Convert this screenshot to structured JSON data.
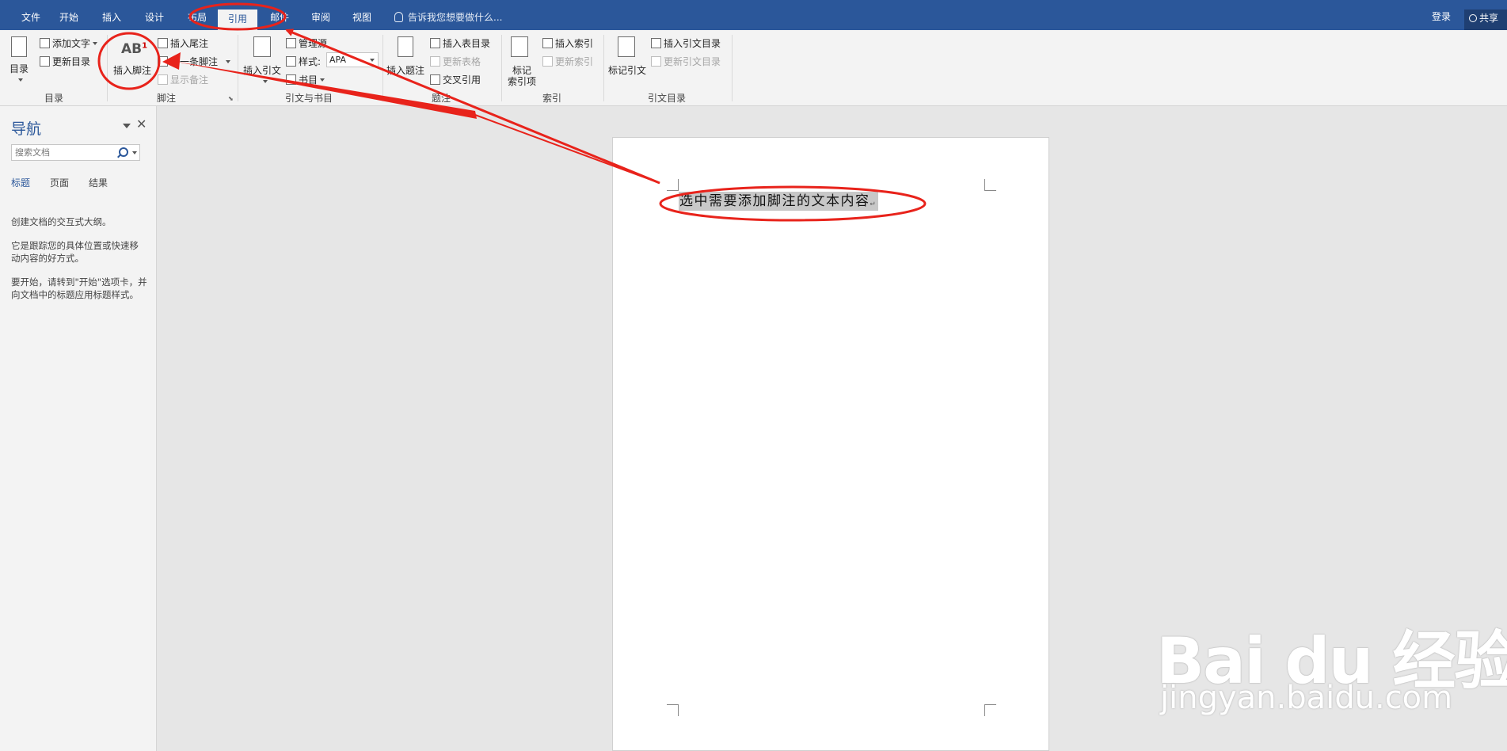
{
  "tabs": [
    {
      "label": "文件"
    },
    {
      "label": "开始"
    },
    {
      "label": "插入"
    },
    {
      "label": "设计"
    },
    {
      "label": "布局"
    },
    {
      "label": "引用"
    },
    {
      "label": "邮件"
    },
    {
      "label": "审阅"
    },
    {
      "label": "视图"
    }
  ],
  "active_tab": "引用",
  "tell_me": "告诉我您想要做什么...",
  "signin": "登录",
  "share": "共享",
  "ribbon": {
    "toc": {
      "toc_button": "目录",
      "add_text": "添加文字",
      "update_toc": "更新目录",
      "group": "目录"
    },
    "footnotes": {
      "insert_footnote_icon_text": "AB",
      "insert_footnote_sup": "1",
      "insert_footnote": "插入脚注",
      "insert_endnote": "插入尾注",
      "next_footnote": "下一条脚注",
      "show_notes": "显示备注",
      "group": "脚注"
    },
    "citations": {
      "insert_citation": "插入引文",
      "manage_sources": "管理源",
      "style_label": "样式:",
      "style_value": "APA",
      "bibliography": "书目",
      "group": "引文与书目"
    },
    "captions": {
      "insert_caption": "插入题注",
      "insert_table_of_figures": "插入表目录",
      "update_table": "更新表格",
      "cross_reference": "交叉引用",
      "group": "题注"
    },
    "index": {
      "mark_entry_1": "标记",
      "mark_entry_2": "索引项",
      "insert_index": "插入索引",
      "update_index": "更新索引",
      "group": "索引"
    },
    "toa": {
      "mark_citation": "标记引文",
      "insert_toa": "插入引文目录",
      "update_toa": "更新引文目录",
      "group": "引文目录"
    }
  },
  "nav": {
    "title": "导航",
    "search_placeholder": "搜索文档",
    "tabs": [
      "标题",
      "页面",
      "结果"
    ],
    "p1": "创建文档的交互式大纲。",
    "p2": "它是跟踪您的具体位置或快速移动内容的好方式。",
    "p3": "要开始，请转到\"开始\"选项卡，并向文档中的标题应用标题样式。"
  },
  "document": {
    "text": "选中需要添加脚注的文本内容",
    "para_mark": "↵"
  },
  "watermark": {
    "logo": "Bai du 经验",
    "url": "jingyan.baidu.com"
  },
  "annotation_color": "#e8231b"
}
